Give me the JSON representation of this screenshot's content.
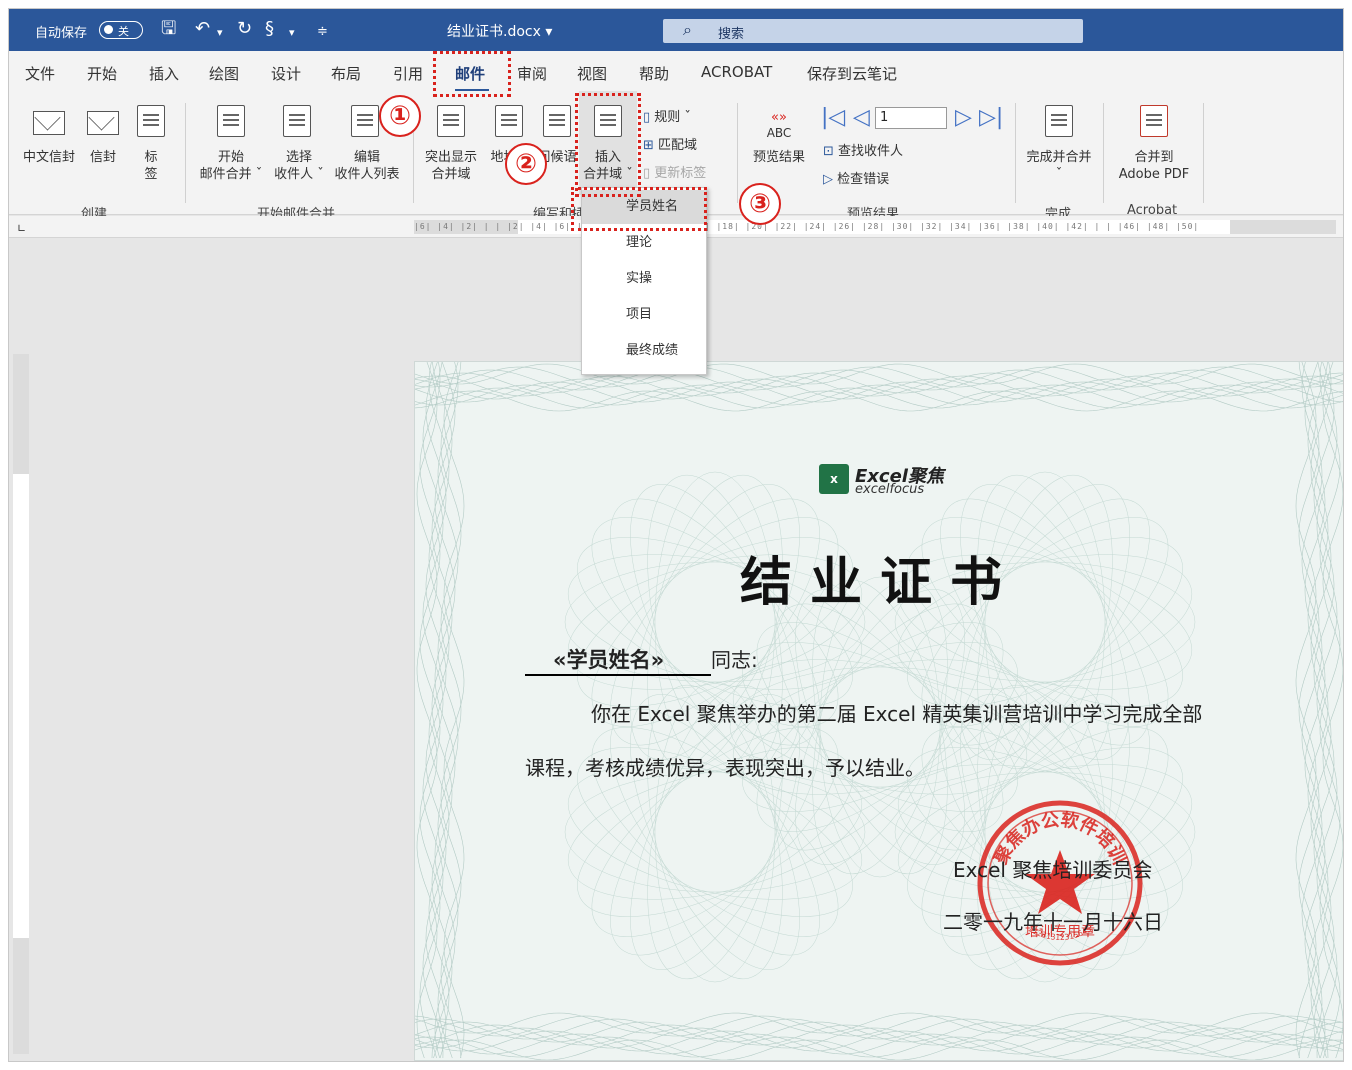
{
  "titlebar": {
    "autosave_label": "自动保存",
    "toggle_state": "关",
    "doc_title": "结业证书.docx",
    "search_placeholder": "搜索"
  },
  "tabs": [
    "文件",
    "开始",
    "插入",
    "绘图",
    "设计",
    "布局",
    "引用",
    "邮件",
    "审阅",
    "视图",
    "帮助",
    "ACROBAT",
    "保存到云笔记"
  ],
  "active_tab": "邮件",
  "ribbon": {
    "create": {
      "label": "创建",
      "cn_envelope": "中文信封",
      "envelope": "信封",
      "labels_1": "标",
      "labels_2": "签"
    },
    "start_merge": {
      "label": "开始邮件合并",
      "start_1": "开始",
      "start_2": "邮件合并 ˇ",
      "select_1": "选择",
      "select_2": "收件人 ˇ",
      "edit_1": "编辑",
      "edit_2": "收件人列表"
    },
    "write_insert": {
      "label": "编写和插入域",
      "highlight_1": "突出显示",
      "highlight_2": "合并域",
      "address_block": "地址块",
      "greeting_line": "问候语",
      "insert_1": "插入",
      "insert_2": "合并域 ˇ",
      "rules": "规则 ˇ",
      "match_fields": "匹配域",
      "update_labels": "更新标签"
    },
    "preview": {
      "label": "预览结果",
      "abc": "ABC",
      "preview_results": "预览结果",
      "record_value": "1",
      "find_recipient": "查找收件人",
      "check_errors": "检查错误"
    },
    "finish": {
      "label": "完成",
      "finish_merge": "完成并合并",
      "finish_arrow": "ˇ"
    },
    "acrobat": {
      "label": "Acrobat",
      "merge_1": "合并到",
      "merge_2": "Adobe PDF"
    }
  },
  "annotations": [
    "①",
    "②",
    "③"
  ],
  "dropdown": {
    "items": [
      "学员姓名",
      "理论",
      "实操",
      "项目",
      "最终成绩"
    ],
    "hovered_index": 0
  },
  "ruler": {
    "ticks": "|6| |4| |2| |  | |2| |4| |6| |8| |10| |12| |14| |16| |18| |20| |22| |24| |26| |28| |30| |32| |34| |36| |38| |40| |42| |  | |46| |48| |50|"
  },
  "certificate": {
    "logo_name": "Excel聚焦",
    "logo_sub": "excelfocus",
    "title": "结业证书",
    "merge_field": "«学员姓名»",
    "comrade": "同志:",
    "body_line1": "你在 Excel 聚焦举办的第二届 Excel 精英集训营培训中学习完成全部",
    "body_line2": "课程，考核成绩优异，表现突出，予以结业。",
    "org": "Excel 聚焦培训委员会",
    "date": "二零一九年十一月十六日",
    "seal_text": "聚焦办公软件培训",
    "seal_bottom": "培训专用章",
    "seal_code": "51231312315645"
  },
  "colors": {
    "titlebar": "#2b579a",
    "annotation": "#d9221d",
    "seal": "#d9221d",
    "excel_green": "#217346"
  }
}
